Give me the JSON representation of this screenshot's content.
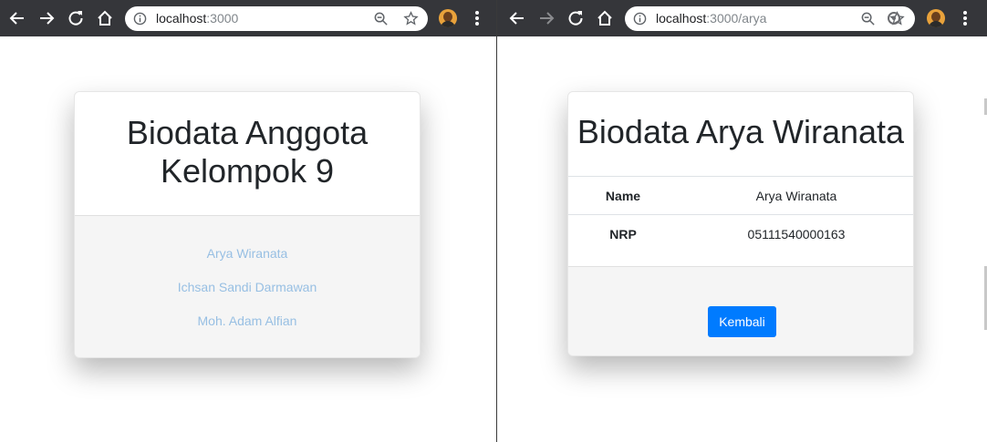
{
  "left_window": {
    "address": {
      "host": "localhost",
      "path": ":3000"
    },
    "card": {
      "title": "Biodata Anggota Kelompok 9",
      "members": [
        "Arya Wiranata",
        "Ichsan Sandi Darmawan",
        "Moh. Adam Alfian"
      ]
    }
  },
  "right_window": {
    "address": {
      "host": "localhost",
      "path": ":3000/arya"
    },
    "card": {
      "title": "Biodata Arya Wiranata",
      "rows": [
        {
          "key": "Name",
          "value": "Arya Wiranata"
        },
        {
          "key": "NRP",
          "value": "05111540000163"
        }
      ],
      "back_label": "Kembali"
    }
  },
  "colors": {
    "toolbar": "#35363a",
    "link": "#97bfe3",
    "primary": "#007bff",
    "footer": "#f5f5f5"
  }
}
